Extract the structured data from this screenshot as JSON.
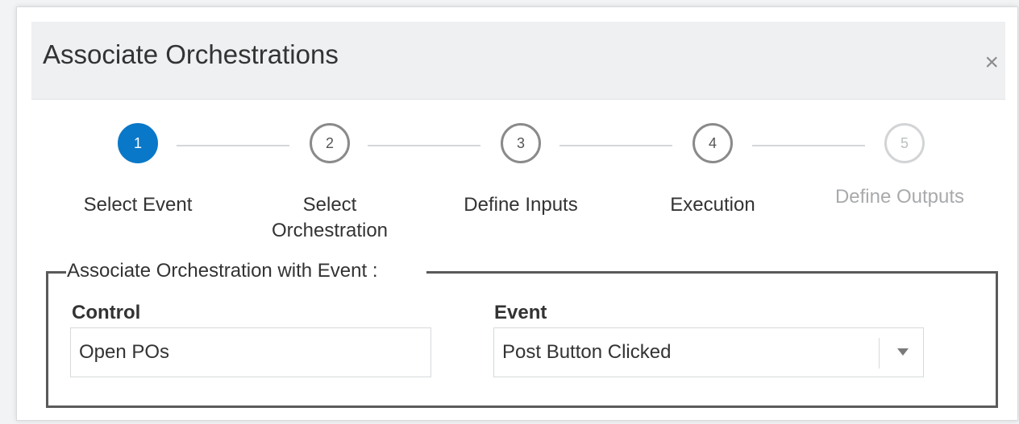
{
  "dialog": {
    "title": "Associate Orchestrations",
    "close_glyph": "×"
  },
  "stepper": {
    "steps": [
      {
        "number": "1",
        "label": "Select Event",
        "state": "active"
      },
      {
        "number": "2",
        "label": "Select Orchestration",
        "state": "normal"
      },
      {
        "number": "3",
        "label": "Define Inputs",
        "state": "normal"
      },
      {
        "number": "4",
        "label": "Execution",
        "state": "normal"
      },
      {
        "number": "5",
        "label": "Define Outputs",
        "state": "disabled"
      }
    ]
  },
  "association": {
    "legend": "Associate Orchestration with Event :",
    "control": {
      "label": "Control",
      "value": "Open POs"
    },
    "event": {
      "label": "Event",
      "value": "Post Button Clicked"
    }
  },
  "colors": {
    "accent": "#0a78c8",
    "header_bg": "#eef0f2",
    "disabled": "#bcbec0"
  },
  "icons": {
    "close": "close-icon",
    "dropdown": "chevron-down-icon"
  }
}
